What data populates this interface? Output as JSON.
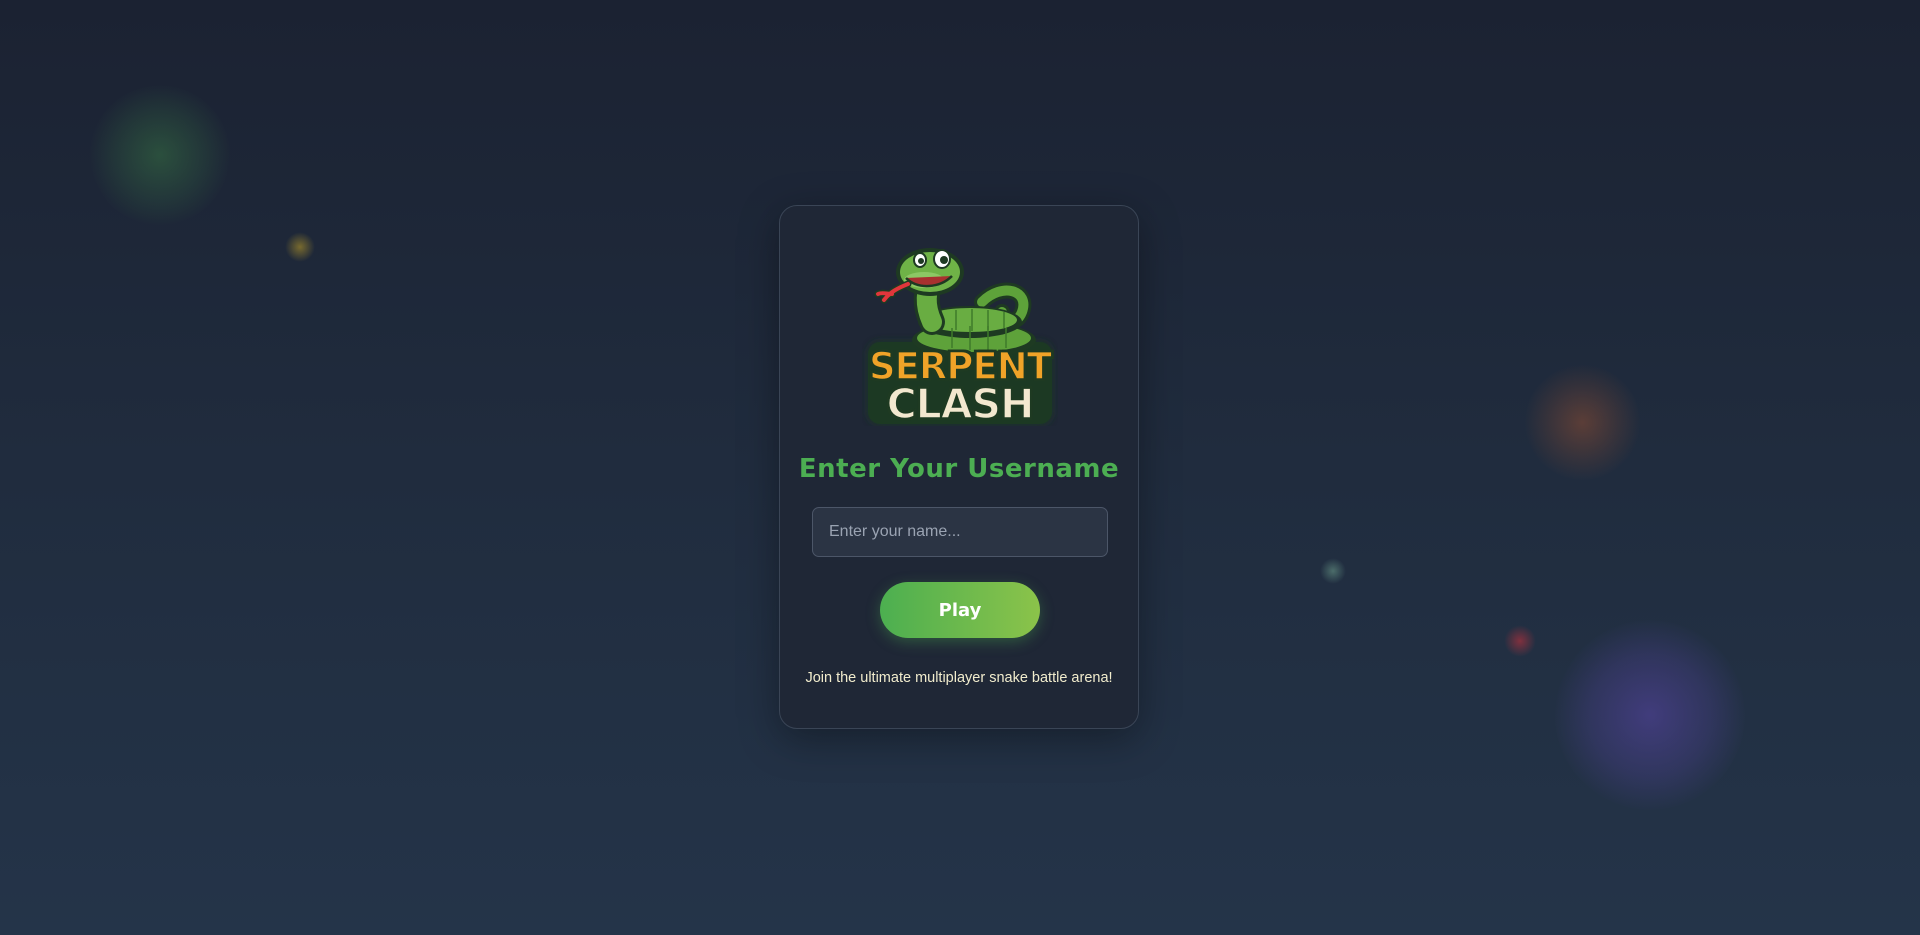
{
  "logo": {
    "line1": "SERPENT",
    "line2": "CLASH"
  },
  "form": {
    "heading": "Enter Your Username",
    "username_placeholder": "Enter your name...",
    "username_value": "",
    "play_label": "Play"
  },
  "tagline": "Join the ultimate multiplayer snake battle arena!",
  "colors": {
    "background_top": "#1b2232",
    "background_bottom": "#243449",
    "card_background": "#1f2736",
    "heading_green": "#4cae52",
    "play_gradient_start": "#4caf50",
    "play_gradient_end": "#8bc34a",
    "logo_orange": "#f0a328",
    "logo_cream": "#f3e8cf",
    "tagline": "#f1eccd"
  }
}
